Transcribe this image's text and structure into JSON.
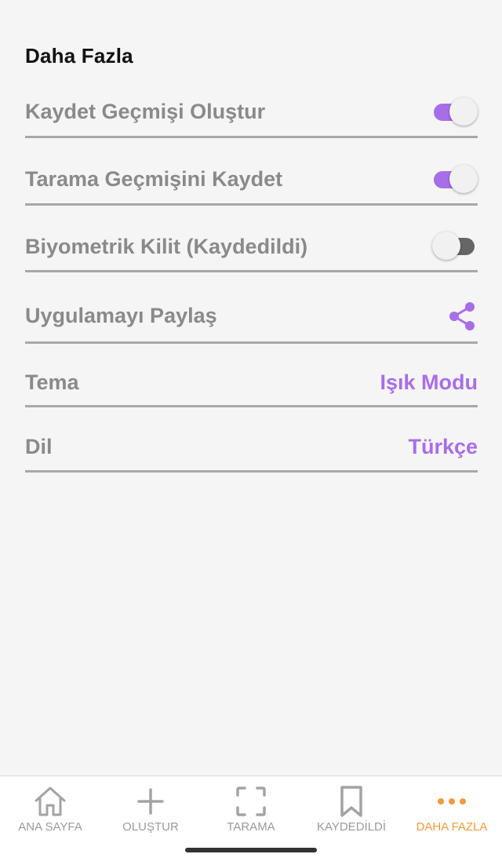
{
  "section_title": "Daha Fazla",
  "settings": [
    {
      "label": "Kaydet Geçmişi Oluştur",
      "type": "toggle",
      "on": true
    },
    {
      "label": "Tarama Geçmişini Kaydet",
      "type": "toggle",
      "on": true
    },
    {
      "label": "Biyometrik Kilit (Kaydedildi)",
      "type": "toggle",
      "on": false
    },
    {
      "label": "Uygulamayı Paylaş",
      "type": "icon",
      "icon": "share-icon"
    },
    {
      "label": "Tema",
      "type": "value",
      "value": "Işık Modu"
    },
    {
      "label": "Dil",
      "type": "value",
      "value": "Türkçe"
    }
  ],
  "nav": {
    "items": [
      {
        "label": "ANA SAYFA",
        "icon": "home-icon"
      },
      {
        "label": "OLUŞTUR",
        "icon": "plus-icon"
      },
      {
        "label": "TARAMA",
        "icon": "scan-icon"
      },
      {
        "label": "KAYDEDİLDİ",
        "icon": "bookmark-icon"
      },
      {
        "label": "DAHA FAZLA",
        "icon": "more-dots-icon",
        "active": true
      }
    ]
  },
  "colors": {
    "accent": "#a86ee8",
    "active_nav": "#f39a3c",
    "label_gray": "#8a8a8a",
    "background": "#f5f5f5"
  }
}
